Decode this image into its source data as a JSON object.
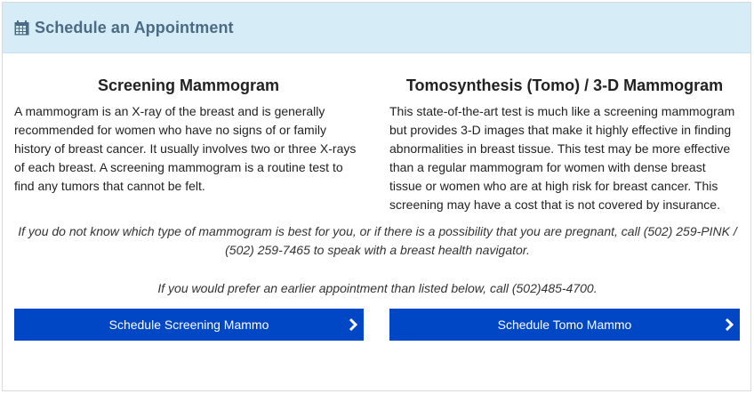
{
  "header": {
    "icon": "calendar-icon",
    "title": "Schedule an Appointment"
  },
  "screening": {
    "heading": "Screening Mammogram",
    "body": "A mammogram is an X-ray of the breast and is generally recommended for women who have no signs of or family history of breast cancer. It usually involves two or three X-rays of each breast. A screening mammogram is a routine test to find any tumors that cannot be felt.",
    "button_label": "Schedule Screening Mammo"
  },
  "tomo": {
    "heading": "Tomosynthesis (Tomo) / 3-D Mammogram",
    "body": "This state-of-the-art test is much like a screening mammogram but provides 3-D images that make it highly effective in finding abnormalities in breast tissue. This test may be more effective than a regular mammogram for women with dense breast tissue or women who are at high risk for breast cancer. This screening may have a cost that is not covered by insurance.",
    "button_label": "Schedule Tomo Mammo"
  },
  "notes": {
    "navigator": "If you do not know which type of mammogram is best for you, or if there is a possibility that you are pregnant, call (502) 259-PINK / (502) 259-7465 to speak with a breast health navigator.",
    "earlier": "If you would prefer an earlier appointment than listed below, call (502)485-4700."
  },
  "colors": {
    "header_bg": "#d6ecf7",
    "header_text": "#4a6a86",
    "button_bg": "#0047c6",
    "button_text": "#ffffff"
  }
}
